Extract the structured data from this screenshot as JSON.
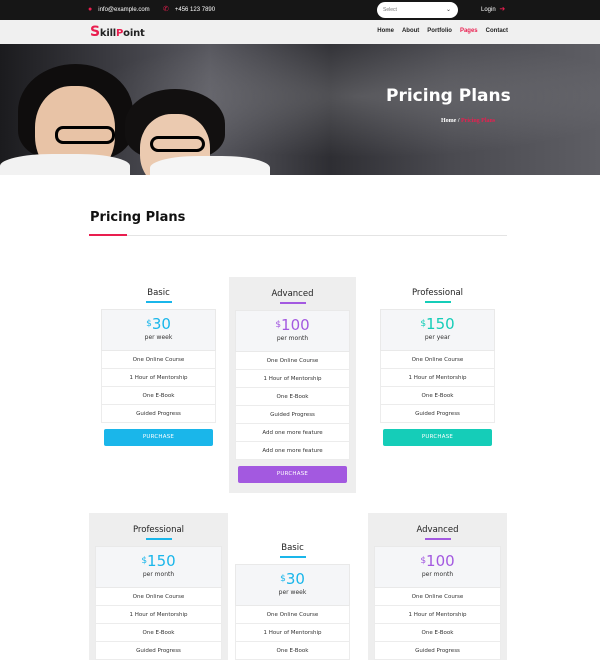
{
  "topbar": {
    "email": "info@example.com",
    "phone": "+456 123 7890",
    "select_placeholder": "Select",
    "login": "Login"
  },
  "logo": {
    "s": "S",
    "kill": "kill",
    "p": "P",
    "oint": "oint"
  },
  "nav": [
    {
      "label": "Home",
      "active": false
    },
    {
      "label": "About",
      "active": false
    },
    {
      "label": "Portfolio",
      "active": false
    },
    {
      "label": "Pages",
      "active": true
    },
    {
      "label": "Contact",
      "active": false
    }
  ],
  "hero": {
    "title": "Pricing Plans",
    "breadcrumb_home": "Home",
    "breadcrumb_sep": "/",
    "breadcrumb_current": "Pricing Plans"
  },
  "section": {
    "title": "Pricing Plans"
  },
  "colors": {
    "accent": "#e91e4f",
    "cyan": "#1ab6ea",
    "purple": "#a359e0",
    "teal": "#15cdb8"
  },
  "plans_row1": [
    {
      "name": "Basic",
      "currency": "$",
      "price": "30",
      "period": "per week",
      "features": [
        "One Online Course",
        "1 Hour of Mentorship",
        "One E-Book",
        "Guided Progress"
      ],
      "button": "PURCHASE",
      "color": "#1ab6ea",
      "featured": false
    },
    {
      "name": "Advanced",
      "currency": "$",
      "price": "100",
      "period": "per month",
      "features": [
        "One Online Course",
        "1 Hour of Mentorship",
        "One E-Book",
        "Guided Progress",
        "Add one more feature",
        "Add one more feature"
      ],
      "button": "PURCHASE",
      "color": "#a359e0",
      "featured": true
    },
    {
      "name": "Professional",
      "currency": "$",
      "price": "150",
      "period": "per year",
      "features": [
        "One Online Course",
        "1 Hour of Mentorship",
        "One E-Book",
        "Guided Progress"
      ],
      "button": "PURCHASE",
      "color": "#15cdb8",
      "featured": false
    }
  ],
  "plans_row2": [
    {
      "name": "Professional",
      "currency": "$",
      "price": "150",
      "period": "per month",
      "features": [
        "One Online Course",
        "1 Hour of Mentorship",
        "One E-Book",
        "Guided Progress"
      ],
      "button": "",
      "color": "#1ab6ea",
      "featured": true
    },
    {
      "name": "Basic",
      "currency": "$",
      "price": "30",
      "period": "per week",
      "features": [
        "One Online Course",
        "1 Hour of Mentorship",
        "One E-Book"
      ],
      "button": "",
      "color": "#1ab6ea",
      "featured": false
    },
    {
      "name": "Advanced",
      "currency": "$",
      "price": "100",
      "period": "per month",
      "features": [
        "One Online Course",
        "1 Hour of Mentorship",
        "One E-Book",
        "Guided Progress"
      ],
      "button": "",
      "color": "#a359e0",
      "featured": true
    }
  ]
}
